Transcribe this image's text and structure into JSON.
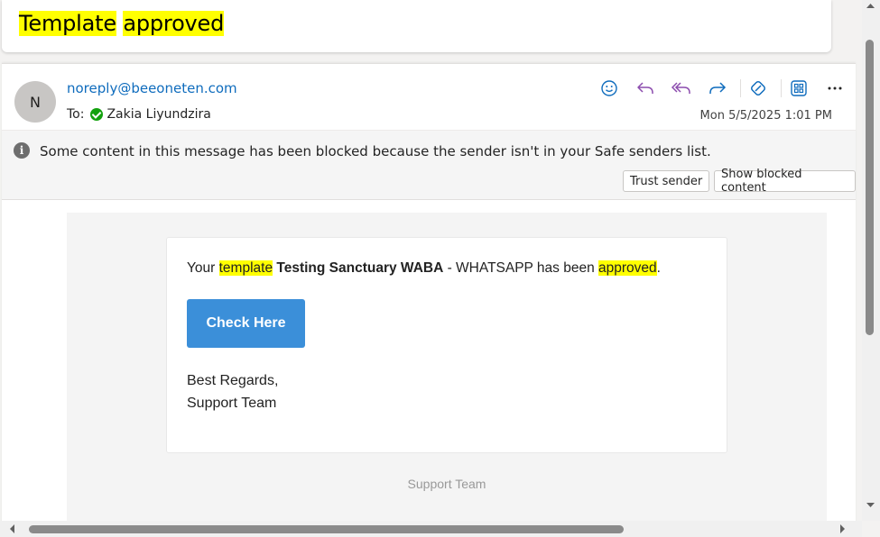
{
  "subject": {
    "word1": "Template",
    "word2": "approved"
  },
  "header": {
    "avatar_initial": "N",
    "from": "noreply@beeoneten.com",
    "to_label": "To:",
    "to_name": "Zakia Liyundzira",
    "date": "Mon 5/5/2025 1:01 PM",
    "toolbar": [
      "emoji-icon",
      "reply-icon",
      "reply-all-icon",
      "forward-icon",
      "loop-icon",
      "apps-icon",
      "more-icon"
    ]
  },
  "banner": {
    "text": "Some content in this message has been blocked because the sender isn't in your Safe senders list.",
    "trust_label": "Trust sender",
    "show_label": "Show blocked content"
  },
  "email": {
    "pre": "Your ",
    "hl_template": "template",
    "name": "Testing Sanctuary WABA",
    "mid": " - WHATSAPP has been ",
    "hl_approved": "approved",
    "end": ".",
    "button_label": "Check Here",
    "regards": "Best Regards,",
    "team": "Support Team",
    "footer": "Support Team"
  },
  "colors": {
    "highlight": "#ffff00",
    "link": "#0f6cbd",
    "button": "#3b8fd9",
    "reply_purple": "#8c4cae"
  }
}
